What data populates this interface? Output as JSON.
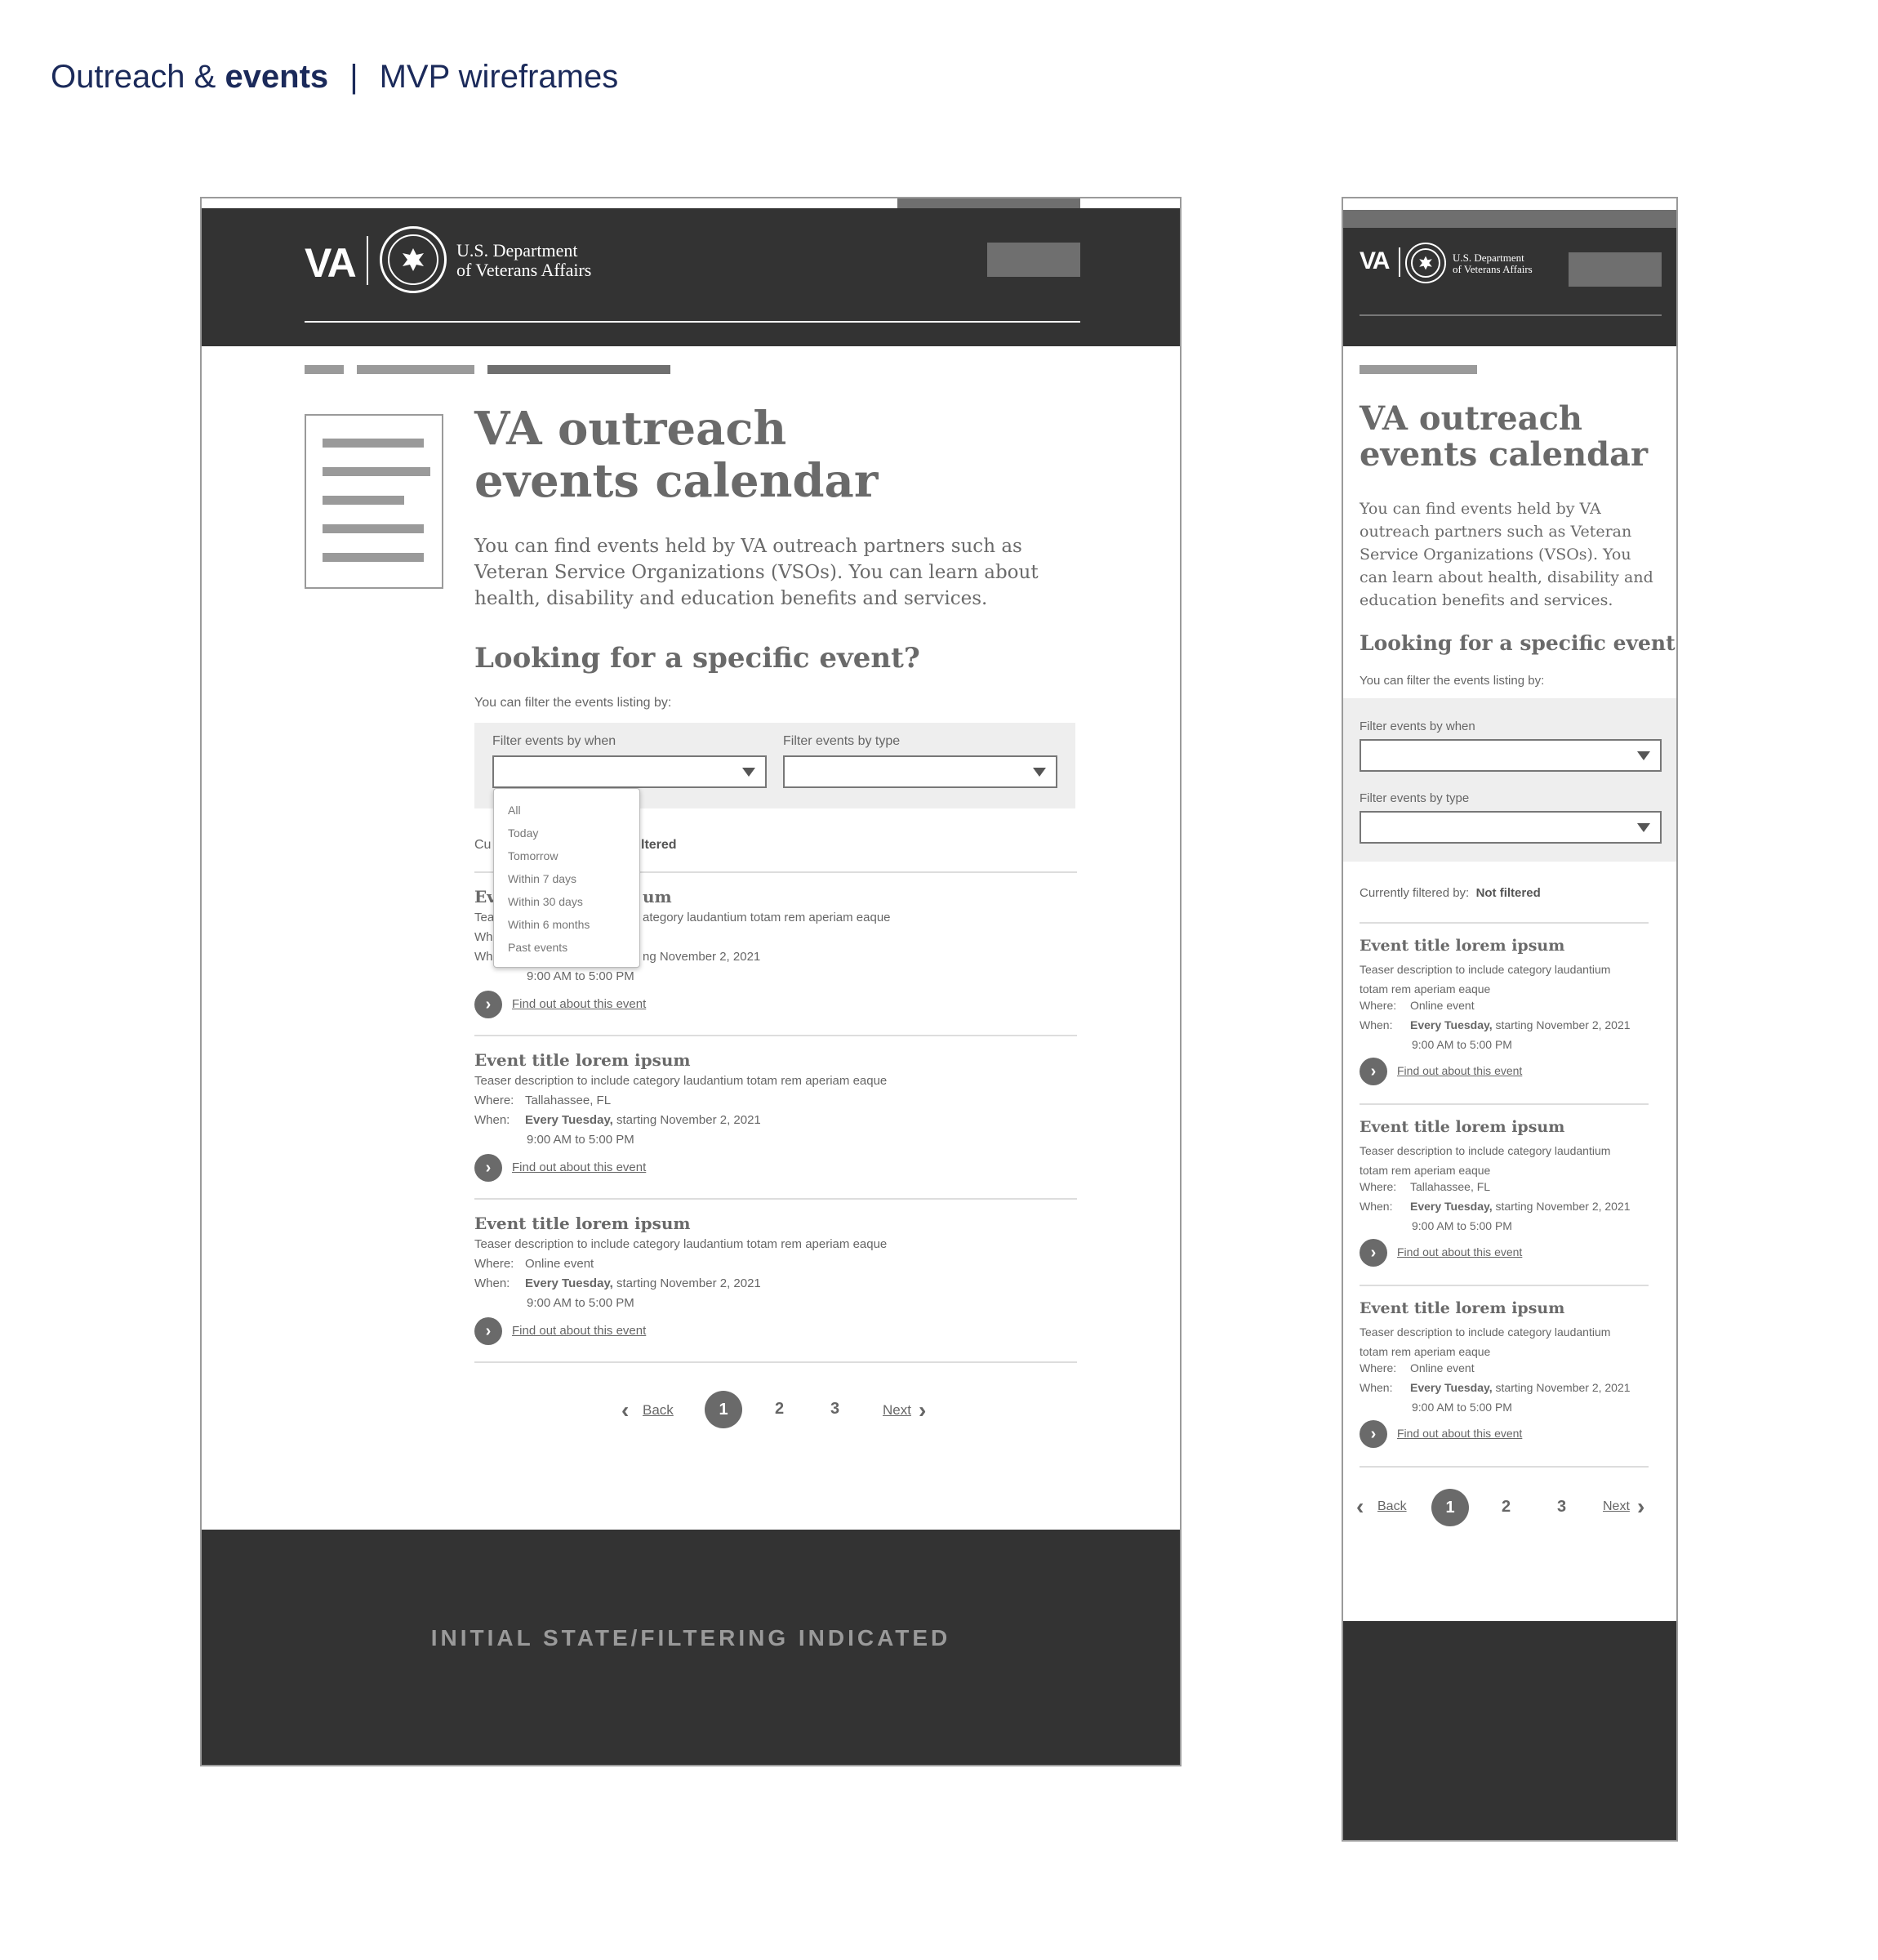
{
  "doc_header": {
    "prefix": "Outreach & ",
    "bold": "events",
    "separator": "|",
    "subtitle": "MVP wireframes"
  },
  "brand": {
    "logo": "VA",
    "dept_line1": "U.S. Department",
    "dept_line2": "of Veterans Affairs",
    "seal_icon": "va-seal-icon"
  },
  "page": {
    "title": "VA outreach events calendar",
    "intro": "You can find events held by VA outreach partners such as Veteran Service Organizations (VSOs). You can learn about health, disability and education benefits and services.",
    "filter_heading": "Looking for a specific event?",
    "filter_intro": "You can filter the events listing by:",
    "filter_when_label": "Filter events by when",
    "filter_type_label": "Filter events by type",
    "currently_filtered_label": "Currently filtered by:",
    "currently_filtered_value": "Not filtered",
    "when_options": [
      "All",
      "Today",
      "Tomorrow",
      "Within 7 days",
      "Within 30 days",
      "Within 6 months",
      "Past events"
    ]
  },
  "desktop_occluded": {
    "filtered_prefix": "Cu",
    "filtered_suffix": "ltered",
    "ev1_title_a": "Ev",
    "ev1_title_b": "um",
    "ev1_teaser_a": "Tea",
    "ev1_teaser_b": "ategory laudantium totam rem aperiam eaque",
    "ev1_where_a": "Wh",
    "ev1_when_a": "Wh",
    "ev1_when_b": "ng November 2, 2021"
  },
  "events": [
    {
      "title": "Event title lorem ipsum",
      "teaser": "Teaser description to include category laudantium totam rem aperiam eaque",
      "where_label": "Where:",
      "where": "Online event",
      "when_label": "When:",
      "when_bold": "Every Tuesday,",
      "when_rest": " starting November 2, 2021",
      "time": "9:00 AM to 5:00 PM",
      "link": "Find out about this event"
    },
    {
      "title": "Event title lorem ipsum",
      "teaser": "Teaser description to include category laudantium totam rem aperiam eaque",
      "where_label": "Where:",
      "where": "Tallahassee, FL",
      "when_label": "When:",
      "when_bold": "Every Tuesday,",
      "when_rest": " starting November 2, 2021",
      "time": "9:00 AM to 5:00 PM",
      "link": "Find out about this event"
    },
    {
      "title": "Event title lorem ipsum",
      "teaser": "Teaser description to include category laudantium totam rem aperiam eaque",
      "where_label": "Where:",
      "where": "Online event",
      "when_label": "When:",
      "when_bold": "Every Tuesday,",
      "when_rest": " starting November 2, 2021",
      "time": "9:00 AM to 5:00 PM",
      "link": "Find out about this event"
    }
  ],
  "mobile_teaser_line1": "Teaser description to include category laudantium",
  "mobile_teaser_line2": "totam rem aperiam eaque",
  "pagination": {
    "back": "Back",
    "pages": [
      "1",
      "2",
      "3"
    ],
    "current": "1",
    "next": "Next"
  },
  "footer_label": "INITIAL STATE/FILTERING INDICATED",
  "colors": {
    "header_dark": "#333333",
    "title_navy": "#1b2a5a",
    "wire_gray": "#6a6a6a"
  }
}
